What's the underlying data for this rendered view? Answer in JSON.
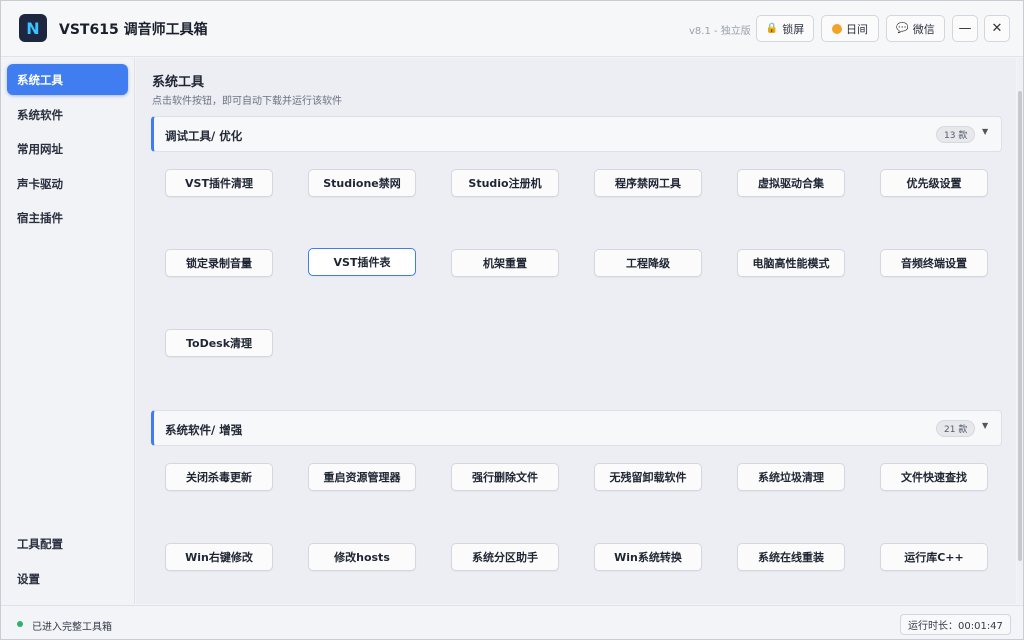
{
  "app": {
    "logo_letter": "N",
    "title": "VST615 调音师工具箱",
    "version": "v8.1 - 独立版",
    "lock_label": "锁屏",
    "theme_label": "日间",
    "wechat_label": "微信",
    "minimize": "—",
    "close": "✕"
  },
  "sidebar": {
    "items": [
      {
        "label": "系统工具",
        "active": true
      },
      {
        "label": "系统软件"
      },
      {
        "label": "常用网址"
      },
      {
        "label": "声卡驱动"
      },
      {
        "label": "宿主插件"
      }
    ],
    "bottom_items": [
      {
        "label": "工具配置"
      },
      {
        "label": "设置"
      }
    ]
  },
  "main": {
    "title": "系统工具",
    "subtitle": "点击软件按钮，即可自动下载并运行该软件",
    "sections": [
      {
        "title": "调试工具/ 优化",
        "count": "13 款",
        "tools": [
          "VST插件清理",
          "Studione禁网",
          "Studio注册机",
          "程序禁网工具",
          "虚拟驱动合集",
          "优先级设置",
          "锁定录制音量",
          "VST插件表",
          "机架重置",
          "工程降级",
          "电脑高性能模式",
          "音频终端设置",
          "ToDesk清理"
        ]
      },
      {
        "title": "系统软件/ 增强",
        "count": "21 款",
        "tools": [
          "关闭杀毒更新",
          "重启资源管理器",
          "强行删除文件",
          "无残留卸载软件",
          "系统垃圾清理",
          "文件快速查找",
          "Win右键修改",
          "修改hosts",
          "系统分区助手",
          "Win系统转换",
          "系统在线重装",
          "运行库C++"
        ]
      }
    ]
  },
  "status": {
    "text": "已进入完整工具箱",
    "runtime": "运行时长：00:01:47"
  },
  "colors": {
    "accent": "#3f7df0",
    "status_ok": "#2fb36a"
  }
}
